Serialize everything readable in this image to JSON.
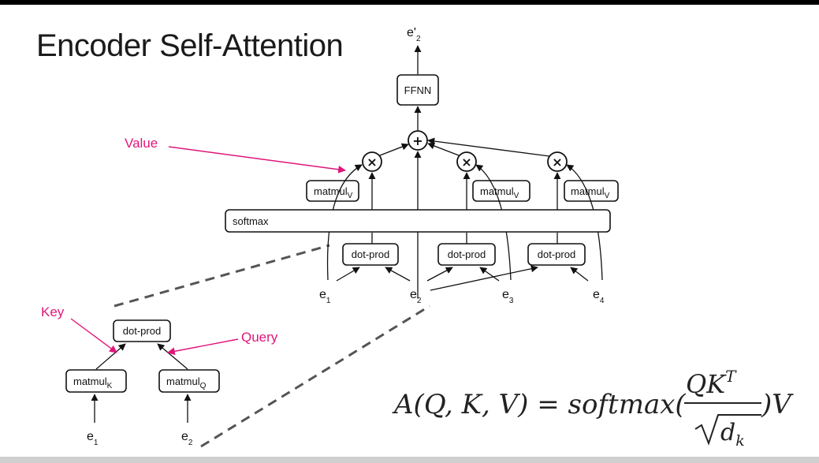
{
  "title": "Encoder Self-Attention",
  "output": {
    "label": "e'",
    "sub": "2"
  },
  "ffnn": "FFNN",
  "softmax": "softmax",
  "matmul": {
    "base": "matmul",
    "v": "V",
    "k": "K",
    "q": "Q"
  },
  "dotprod": "dot-prod",
  "ops": {
    "plus": "+",
    "times": "×"
  },
  "inputs": [
    {
      "label": "e",
      "sub": "1"
    },
    {
      "label": "e",
      "sub": "2"
    },
    {
      "label": "e",
      "sub": "3"
    },
    {
      "label": "e",
      "sub": "4"
    }
  ],
  "annotations": {
    "value": "Value",
    "key": "Key",
    "query": "Query"
  },
  "formula": {
    "lhs": "A(Q, K, V) = softmax(",
    "numerator": "QK",
    "numerator_sup": "T",
    "denominator": "d",
    "denominator_sub": "k",
    "rhs": ")V"
  },
  "colors": {
    "annotation": "#e0157a",
    "background": "#ffffff"
  }
}
